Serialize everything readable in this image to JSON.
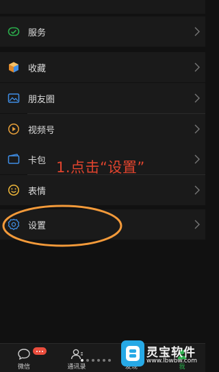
{
  "menu": {
    "items": [
      {
        "label": "服务",
        "icon": "service-icon",
        "color": "#2bae4c"
      },
      {
        "label": "收藏",
        "icon": "favorites-cube-icon",
        "color": "#f1a238"
      },
      {
        "label": "朋友圈",
        "icon": "moments-image-icon",
        "color": "#3f8ee6"
      },
      {
        "label": "视频号",
        "icon": "channels-play-icon",
        "color": "#e8a03a"
      },
      {
        "label": "卡包",
        "icon": "card-wallet-icon",
        "color": "#3f8ee6"
      },
      {
        "label": "表情",
        "icon": "emoji-smile-icon",
        "color": "#f0b83a"
      },
      {
        "label": "设置",
        "icon": "settings-gear-icon",
        "color": "#3f8ee6"
      }
    ]
  },
  "annotation": {
    "text": "1.点击“设置”",
    "color": "#e0442e",
    "highlight_color": "#f39a3a"
  },
  "tabbar": {
    "tabs": [
      {
        "label": "微信",
        "icon": "chat-icon"
      },
      {
        "label": "通讯录",
        "icon": "contacts-icon"
      },
      {
        "label": "发现",
        "icon": "discover-icon"
      },
      {
        "label": "我",
        "icon": "me-icon",
        "active": true,
        "active_color": "#2bae4c"
      }
    ]
  },
  "watermark": {
    "name": "灵宝软件",
    "url": "www.lbwbw.com",
    "brand_color": "#27a9e6"
  }
}
